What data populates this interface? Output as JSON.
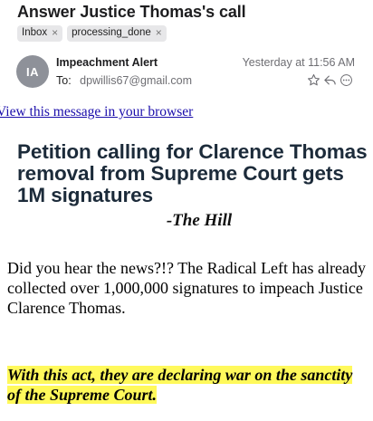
{
  "email": {
    "subject": "Answer Justice Thomas's call",
    "tags": [
      {
        "label": "Inbox",
        "remove": "×"
      },
      {
        "label": "processing_done",
        "remove": "×"
      }
    ],
    "avatar_initials": "IA",
    "sender": "Impeachment Alert",
    "to_label": "To:",
    "to_address": "dpwillis67@gmail.com",
    "date": "Yesterday at 11:56 AM",
    "action_icons": [
      "star-icon",
      "reply-icon",
      "more-icon"
    ]
  },
  "content": {
    "browser_link": "View this message in your browser",
    "headline": "Petition calling for Clarence Thomas removal from Supreme Court gets 1M signatures",
    "attribution": "-The Hill",
    "body": "Did you hear the news?!? The Radical Left has already collected over 1,000,000 signatures to impeach Justice Clarence Thomas.",
    "highlight_quote": "With this act, they are declaring war on the sanctity of the Supreme Court."
  },
  "colors": {
    "highlight": "#fff95b",
    "link": "#1a0dab",
    "headline": "#1c2b3a",
    "avatar": "#8e9199"
  }
}
